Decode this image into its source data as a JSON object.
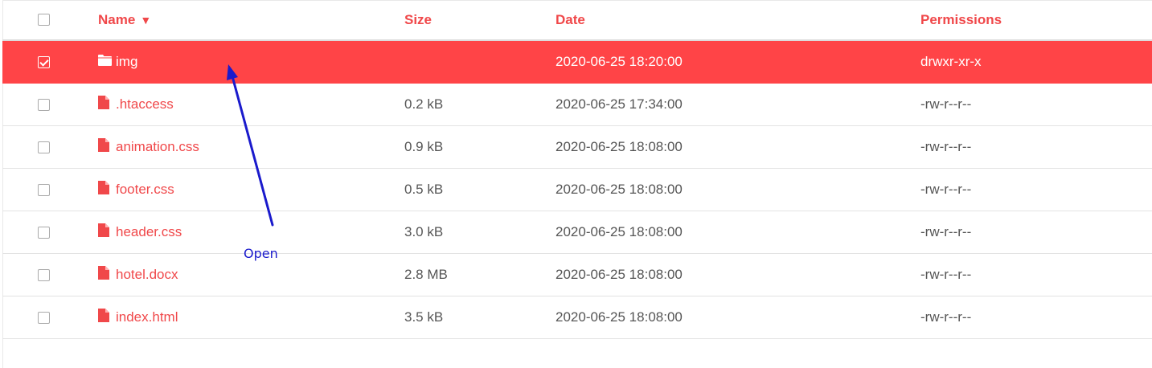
{
  "header": {
    "name_label": "Name",
    "sort_indicator": "▼",
    "size_label": "Size",
    "date_label": "Date",
    "permissions_label": "Permissions"
  },
  "files": [
    {
      "name": "img",
      "size": "",
      "date": "2020-06-25 18:20:00",
      "permissions": "drwxr-xr-x",
      "type": "folder",
      "icon": "folder-icon",
      "selected": true
    },
    {
      "name": ".htaccess",
      "size": "0.2 kB",
      "date": "2020-06-25 17:34:00",
      "permissions": "-rw-r--r--",
      "type": "file",
      "icon": "file-icon",
      "selected": false
    },
    {
      "name": "animation.css",
      "size": "0.9 kB",
      "date": "2020-06-25 18:08:00",
      "permissions": "-rw-r--r--",
      "type": "file",
      "icon": "file-icon",
      "selected": false
    },
    {
      "name": "footer.css",
      "size": "0.5 kB",
      "date": "2020-06-25 18:08:00",
      "permissions": "-rw-r--r--",
      "type": "file",
      "icon": "file-icon",
      "selected": false
    },
    {
      "name": "header.css",
      "size": "3.0 kB",
      "date": "2020-06-25 18:08:00",
      "permissions": "-rw-r--r--",
      "type": "file",
      "icon": "file-icon",
      "selected": false
    },
    {
      "name": "hotel.docx",
      "size": "2.8 MB",
      "date": "2020-06-25 18:08:00",
      "permissions": "-rw-r--r--",
      "type": "file",
      "icon": "file-icon",
      "selected": false
    },
    {
      "name": "index.html",
      "size": "3.5 kB",
      "date": "2020-06-25 18:08:00",
      "permissions": "-rw-r--r--",
      "type": "file",
      "icon": "file-icon",
      "selected": false
    }
  ],
  "annotation": {
    "label": "Open",
    "color": "#1a1acc"
  },
  "colors": {
    "accent": "#ff4447",
    "header_text": "#f0484a",
    "body_text": "#555555"
  }
}
